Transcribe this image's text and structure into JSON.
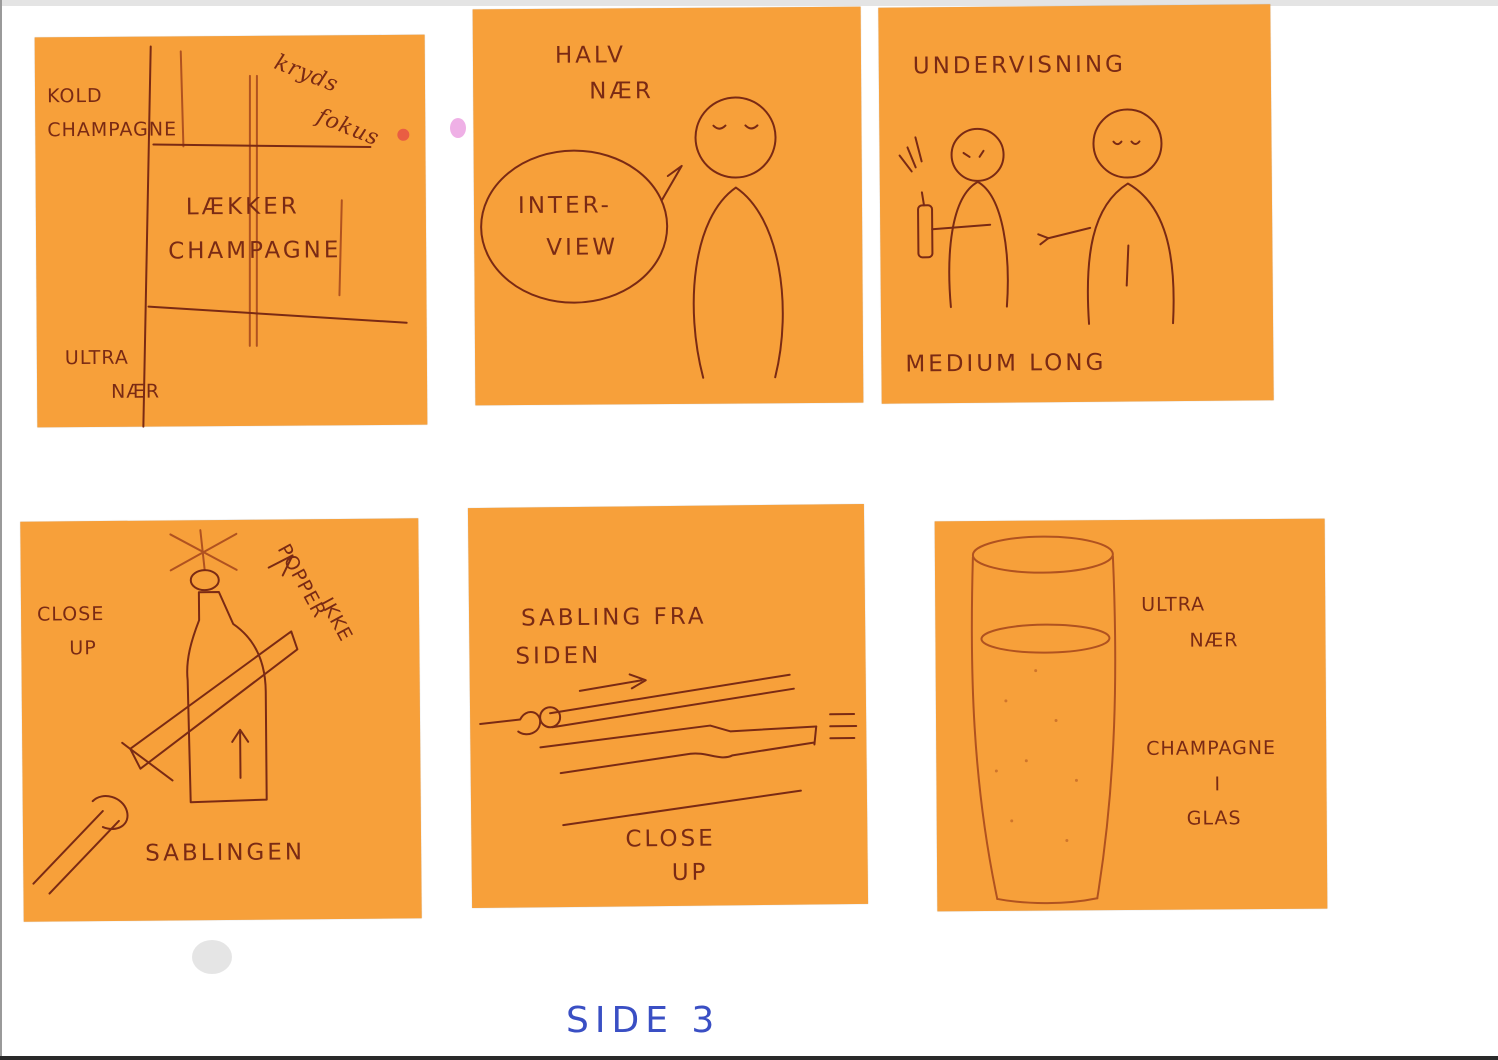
{
  "page_label": "SIDE 3",
  "notes": [
    {
      "id": "note-1",
      "texts": {
        "kold": "KOLD",
        "champagne": "CHAMPAGNE",
        "kryds": "kryds",
        "fokus": "fokus",
        "laekker": "LÆKKER",
        "champagne_main": "CHAMPAGNE",
        "shot_line1": "ULTRA",
        "shot_line2": "NÆR"
      }
    },
    {
      "id": "note-2",
      "texts": {
        "shot_line1": "HALV",
        "shot_line2": "NÆR",
        "bubble_line1": "INTER-",
        "bubble_line2": "VIEW"
      }
    },
    {
      "id": "note-3",
      "texts": {
        "title": "UNDERVISNING",
        "shot": "MEDIUM LONG"
      }
    },
    {
      "id": "note-4",
      "texts": {
        "shot_line1": "CLOSE",
        "shot_line2": "UP",
        "popper_line1": "POPPER",
        "popper_line2": "IKKE",
        "caption": "SABLINGEN"
      }
    },
    {
      "id": "note-5",
      "texts": {
        "title_line1": "SABLING FRA",
        "title_line2": "SIDEN",
        "shot_line1": "CLOSE",
        "shot_line2": "UP"
      }
    },
    {
      "id": "note-6",
      "texts": {
        "shot_line1": "ULTRA",
        "shot_line2": "NÆR",
        "caption_line1": "CHAMPAGNE",
        "caption_line2": "I",
        "caption_line3": "GLAS"
      }
    }
  ],
  "colors": {
    "sticky_note": "#f7a03a",
    "pen_ink": "#7a2a14",
    "page_label_ink": "#3a4fc4"
  }
}
